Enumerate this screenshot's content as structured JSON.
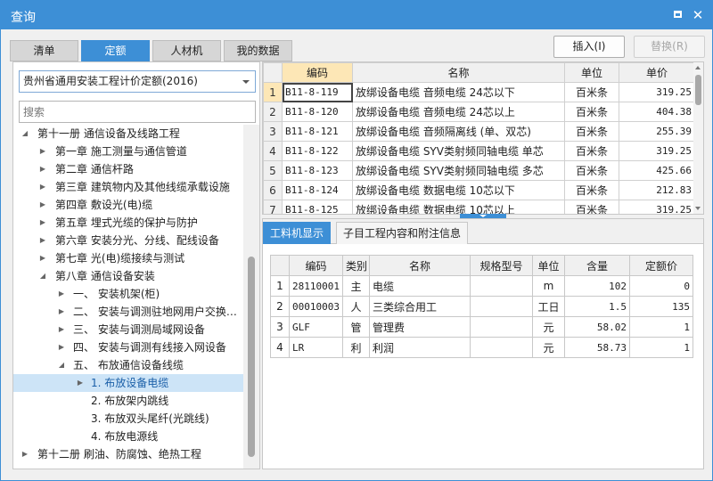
{
  "window": {
    "title": "查询",
    "maximize_icon": "maximize-icon",
    "close_icon": "close-icon",
    "close_glyph": "✕"
  },
  "tabs": [
    {
      "label": "清单",
      "active": false
    },
    {
      "label": "定额",
      "active": true
    },
    {
      "label": "人材机",
      "active": false
    },
    {
      "label": "我的数据",
      "active": false
    }
  ],
  "buttons": {
    "insert": "插入(I)",
    "replace": "替换(R)"
  },
  "quota_library": {
    "selected": "贵州省通用安装工程计价定额(2016)"
  },
  "search": {
    "placeholder": "搜索",
    "value": ""
  },
  "tree": [
    {
      "label": "第十一册 通信设备及线路工程",
      "expanded": true,
      "level": 0
    },
    {
      "label": "第一章 施工测量与通信管道",
      "expanded": false,
      "level": 1
    },
    {
      "label": "第二章 通信杆路",
      "expanded": false,
      "level": 1
    },
    {
      "label": "第三章 建筑物内及其他线缆承载设施",
      "expanded": false,
      "level": 1
    },
    {
      "label": "第四章 敷设光(电)缆",
      "expanded": false,
      "level": 1
    },
    {
      "label": "第五章 埋式光缆的保护与防护",
      "expanded": false,
      "level": 1
    },
    {
      "label": "第六章 安装分光、分线、配线设备",
      "expanded": false,
      "level": 1
    },
    {
      "label": "第七章 光(电)缆接续与测试",
      "expanded": false,
      "level": 1
    },
    {
      "label": "第八章 通信设备安装",
      "expanded": true,
      "level": 1
    },
    {
      "label": "一、 安装机架(柜)",
      "expanded": false,
      "level": 2
    },
    {
      "label": "二、 安装与调测驻地网用户交换…",
      "expanded": false,
      "level": 2
    },
    {
      "label": "三、 安装与调测局域网设备",
      "expanded": false,
      "level": 2
    },
    {
      "label": "四、 安装与调测有线接入网设备",
      "expanded": false,
      "level": 2
    },
    {
      "label": "五、 布放通信设备线缆",
      "expanded": true,
      "level": 2
    },
    {
      "label": "1. 布放设备电缆",
      "expanded": false,
      "level": 3,
      "selected": true
    },
    {
      "label": "2. 布放架内跳线",
      "level": 3
    },
    {
      "label": "3. 布放双头尾纤(光跳线)",
      "level": 3
    },
    {
      "label": "4. 布放电源线",
      "level": 3
    },
    {
      "label": "第十二册 刷油、防腐蚀、绝热工程",
      "expanded": false,
      "level": 0
    }
  ],
  "quota_table": {
    "headers": {
      "code": "编码",
      "name": "名称",
      "unit": "单位",
      "price": "单价"
    },
    "rows": [
      {
        "n": "1",
        "code": "B11-8-119",
        "name": "放绑设备电缆 音频电缆 24芯以下",
        "unit": "百米条",
        "price": "319.25"
      },
      {
        "n": "2",
        "code": "B11-8-120",
        "name": "放绑设备电缆 音频电缆 24芯以上",
        "unit": "百米条",
        "price": "404.38"
      },
      {
        "n": "3",
        "code": "B11-8-121",
        "name": "放绑设备电缆 音频隔离线 (单、双芯)",
        "unit": "百米条",
        "price": "255.39"
      },
      {
        "n": "4",
        "code": "B11-8-122",
        "name": "放绑设备电缆 SYV类射频同轴电缆 单芯",
        "unit": "百米条",
        "price": "319.25"
      },
      {
        "n": "5",
        "code": "B11-8-123",
        "name": "放绑设备电缆 SYV类射频同轴电缆 多芯",
        "unit": "百米条",
        "price": "425.66"
      },
      {
        "n": "6",
        "code": "B11-8-124",
        "name": "放绑设备电缆 数据电缆 10芯以下",
        "unit": "百米条",
        "price": "212.83"
      },
      {
        "n": "7",
        "code": "B11-8-125",
        "name": "放绑设备电缆 数据电缆 10芯以上",
        "unit": "百米条",
        "price": "319.25"
      }
    ]
  },
  "detail_tabs": [
    {
      "label": "工料机显示",
      "active": true
    },
    {
      "label": "子目工程内容和附注信息",
      "active": false
    }
  ],
  "resource_table": {
    "headers": {
      "code": "编码",
      "category": "类别",
      "name": "名称",
      "spec": "规格型号",
      "unit": "单位",
      "qty": "含量",
      "price": "定额价"
    },
    "rows": [
      {
        "n": "1",
        "code": "28110001",
        "category": "主",
        "name": "电缆",
        "spec": "",
        "unit": "m",
        "qty": "102",
        "price": "0"
      },
      {
        "n": "2",
        "code": "00010003",
        "category": "人",
        "name": "三类综合用工",
        "spec": "",
        "unit": "工日",
        "qty": "1.5",
        "price": "135"
      },
      {
        "n": "3",
        "code": "GLF",
        "category": "管",
        "name": "管理费",
        "spec": "",
        "unit": "元",
        "qty": "58.02",
        "price": "1"
      },
      {
        "n": "4",
        "code": "LR",
        "category": "利",
        "name": "利润",
        "spec": "",
        "unit": "元",
        "qty": "58.73",
        "price": "1"
      }
    ]
  }
}
